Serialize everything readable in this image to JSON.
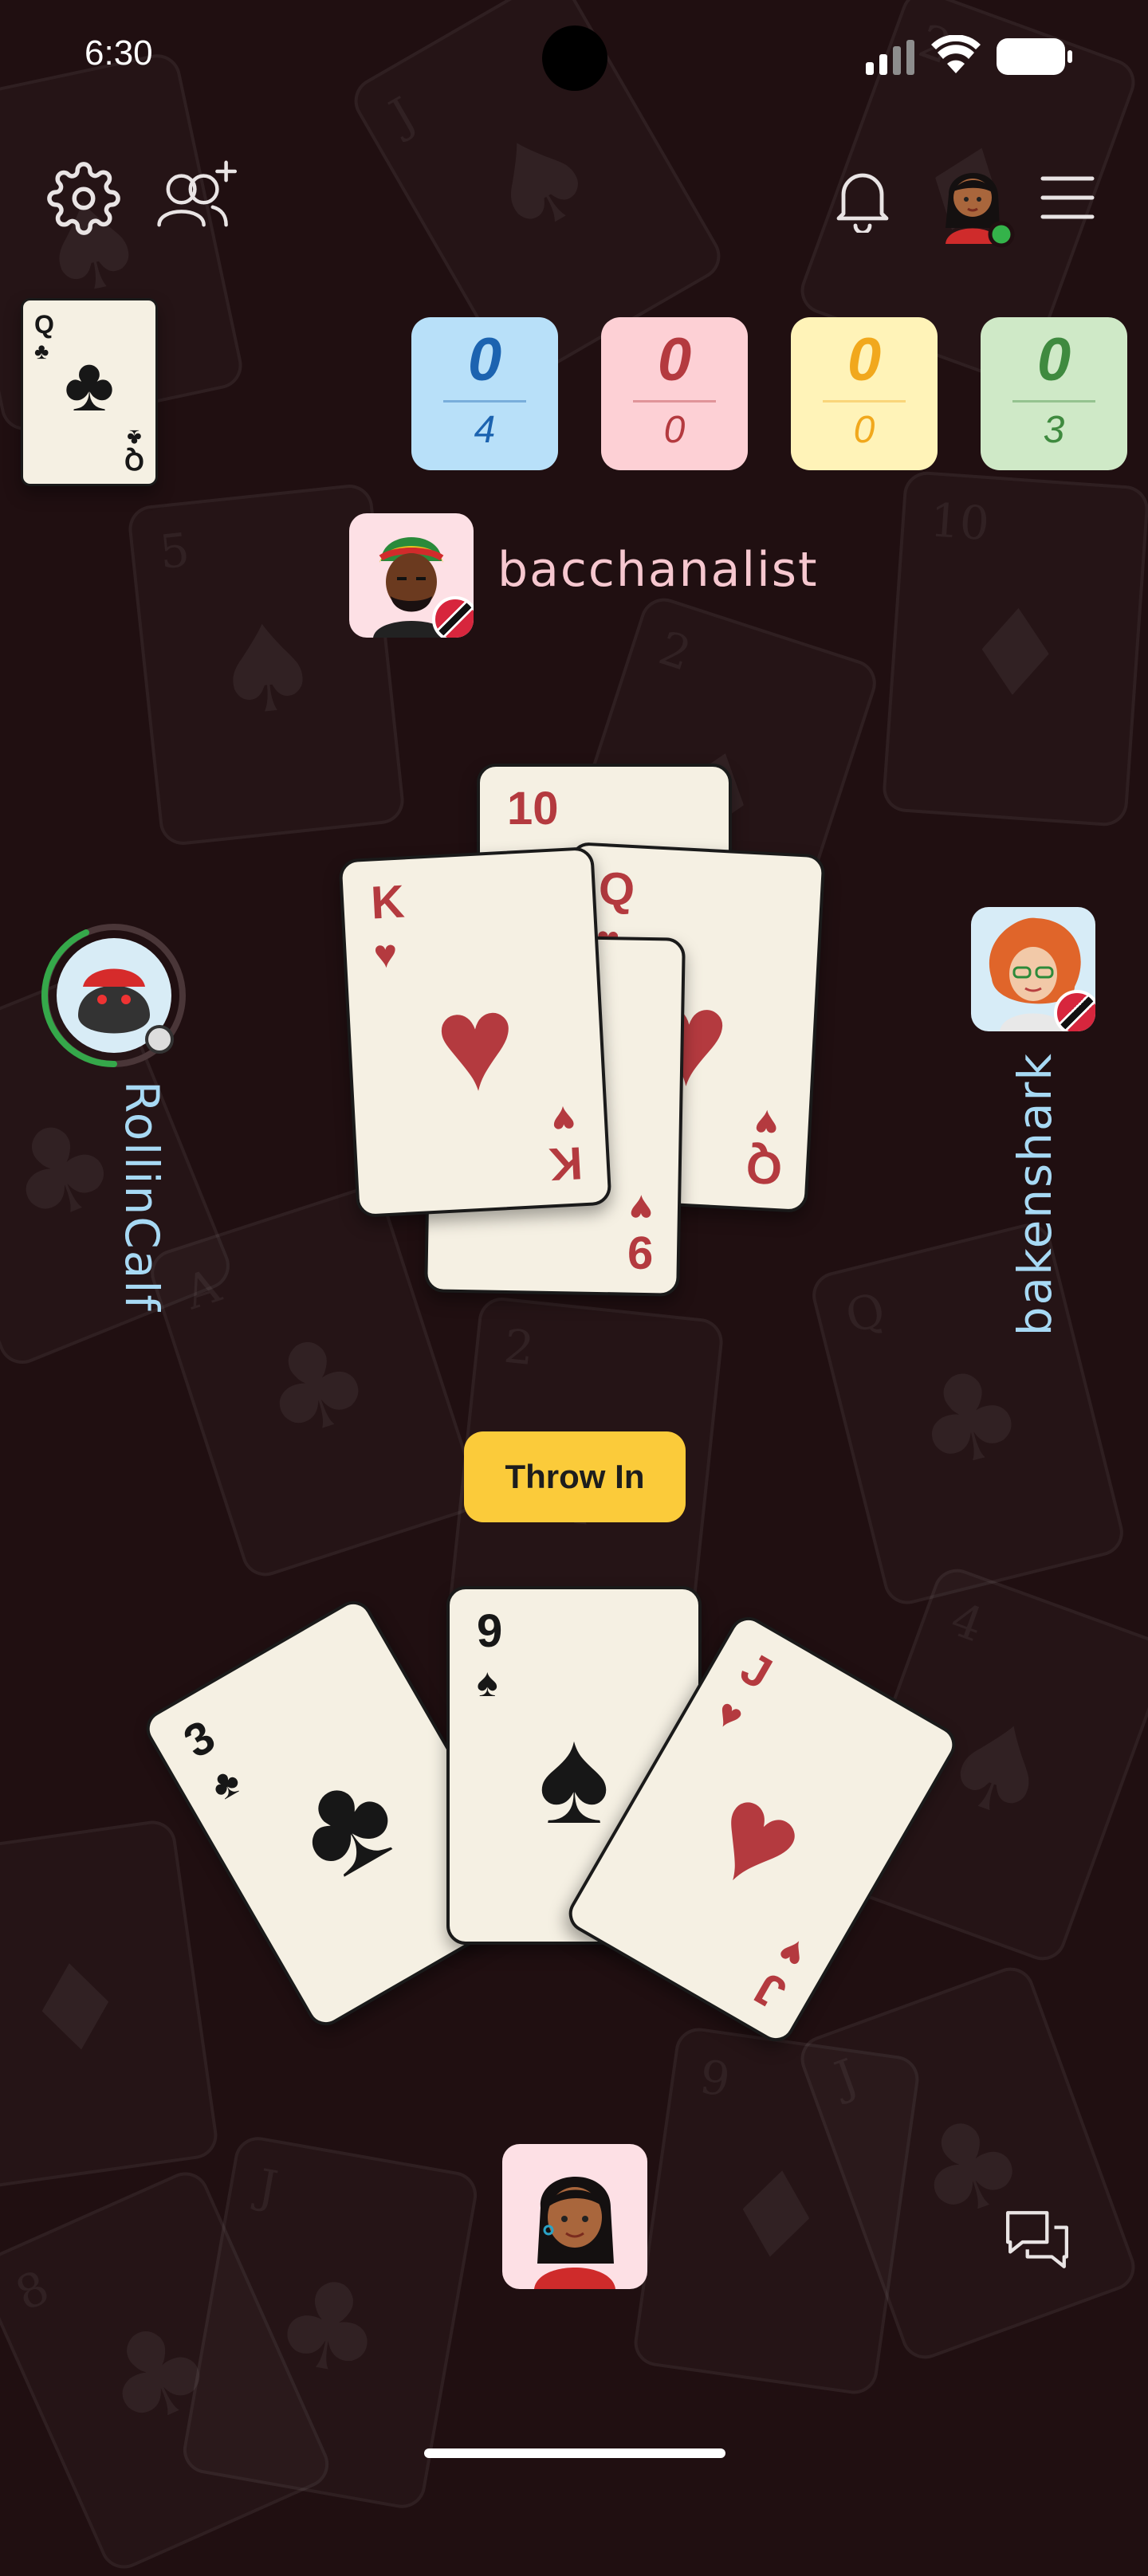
{
  "status_bar": {
    "time": "6:30"
  },
  "header": {
    "settings_icon": "gear-icon",
    "friends_icon": "add-friends-icon",
    "notification_icon": "bell-icon",
    "menu_icon": "hamburger-menu-icon"
  },
  "trump_card": {
    "rank": "Q",
    "suit": "♣",
    "color": "#171717"
  },
  "scores": [
    {
      "top": "0",
      "bottom": "4",
      "bg": "#b8e0f9",
      "color": "#1c63b0"
    },
    {
      "top": "0",
      "bottom": "0",
      "bg": "#fdd0d5",
      "color": "#b43a3f"
    },
    {
      "top": "0",
      "bottom": "0",
      "bg": "#fff3b8",
      "color": "#f1a81d"
    },
    {
      "top": "0",
      "bottom": "3",
      "bg": "#cfe9c7",
      "color": "#3f8a3f"
    }
  ],
  "players": {
    "top": "bacchanalist",
    "left": "RollinCalf",
    "right": "bakenshark"
  },
  "table_cards": [
    {
      "rank": "10",
      "suit": "♥"
    },
    {
      "rank": "Q",
      "suit": "♥"
    },
    {
      "rank": "9",
      "suit": "♥"
    },
    {
      "rank": "K",
      "suit": "♥"
    }
  ],
  "actions": {
    "throw_in": "Throw In"
  },
  "hand_cards": [
    {
      "rank": "3",
      "suit": "♣"
    },
    {
      "rank": "9",
      "suit": "♠"
    },
    {
      "rank": "J",
      "suit": "♥"
    }
  ],
  "chat_icon": "chat-icon"
}
